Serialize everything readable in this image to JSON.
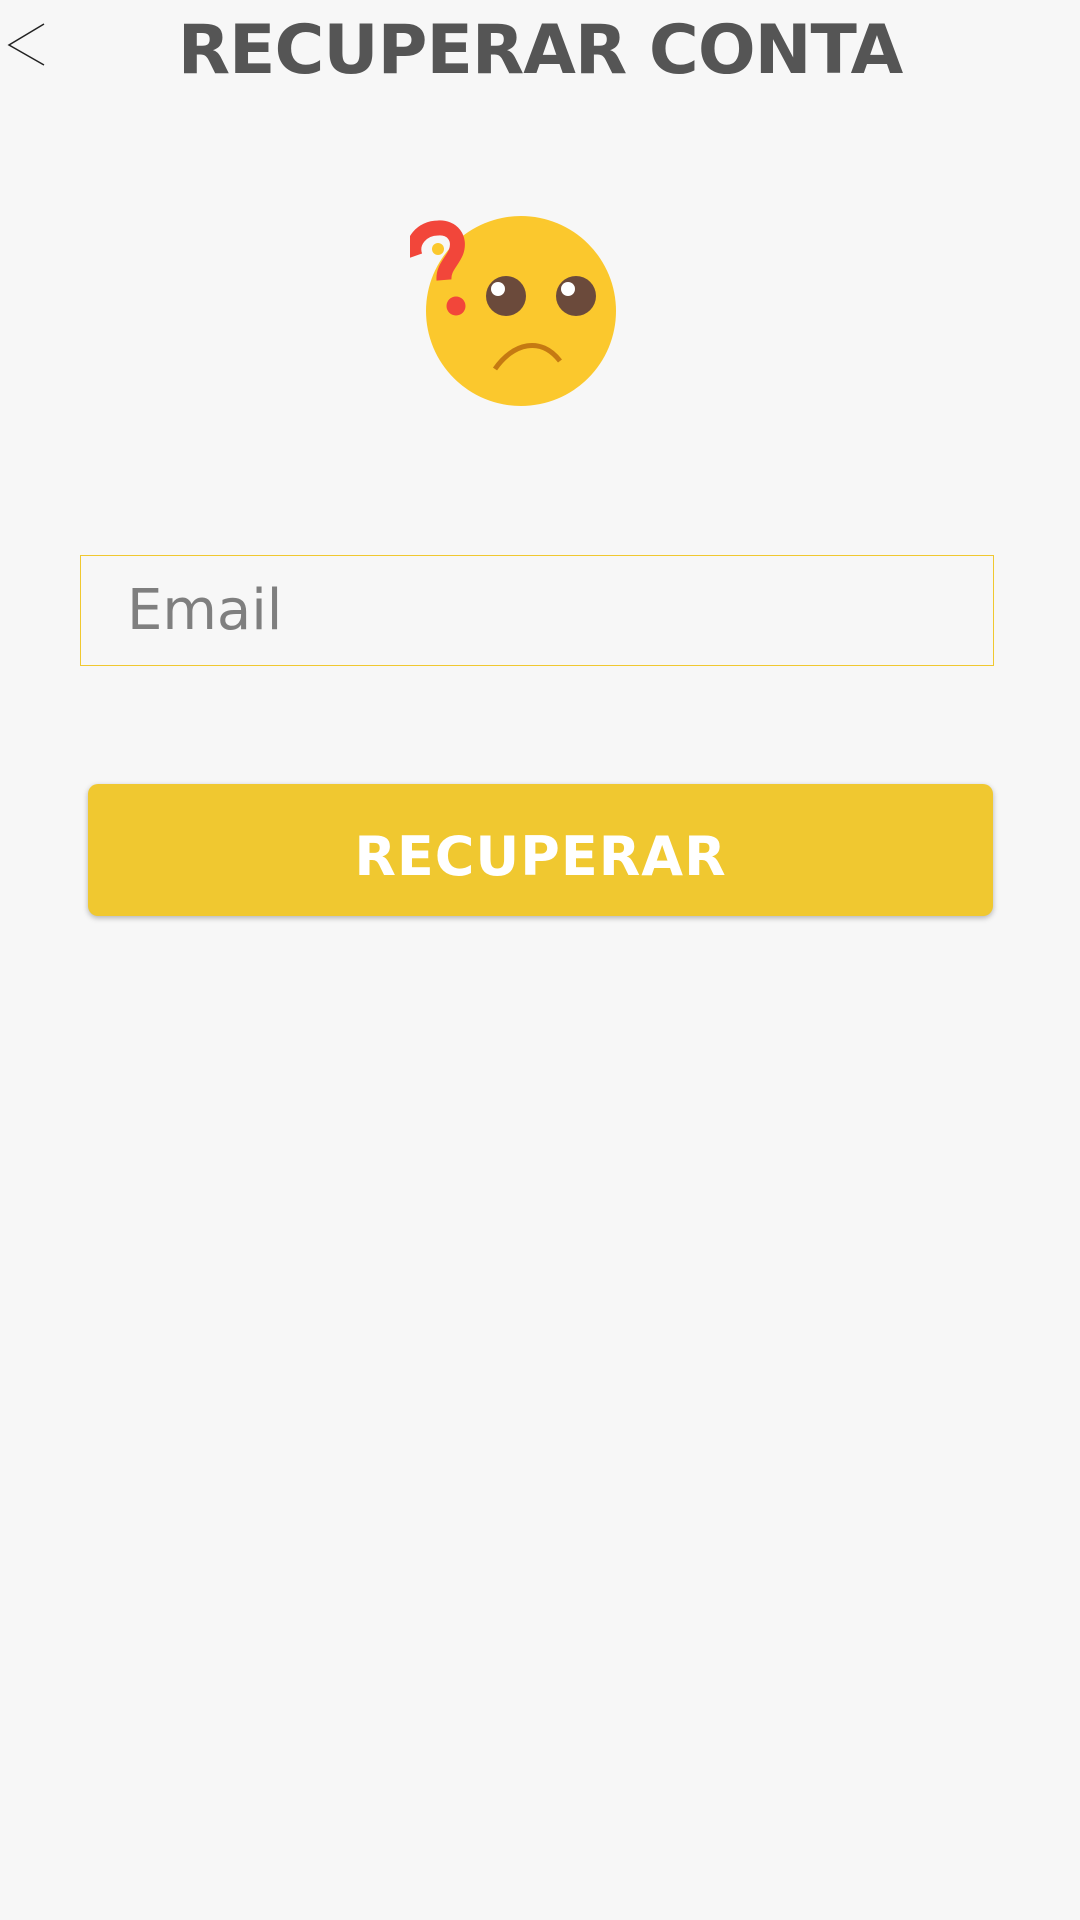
{
  "header": {
    "title": "RECUPERAR CONTA",
    "back_icon": "chevron-left-icon"
  },
  "illustration": {
    "icon": "confused-face-question-mark-icon",
    "colors": {
      "face": "#fbc82d",
      "question_mark": "#f2463a",
      "eyes": "#6b4a3b",
      "mouth": "#c57a12"
    }
  },
  "form": {
    "email": {
      "placeholder": "Email",
      "value": ""
    },
    "submit_label": "RECUPERAR"
  },
  "colors": {
    "background": "#f7f7f7",
    "accent": "#f0c830",
    "title_text": "#555555",
    "button_text": "#ffffff"
  }
}
